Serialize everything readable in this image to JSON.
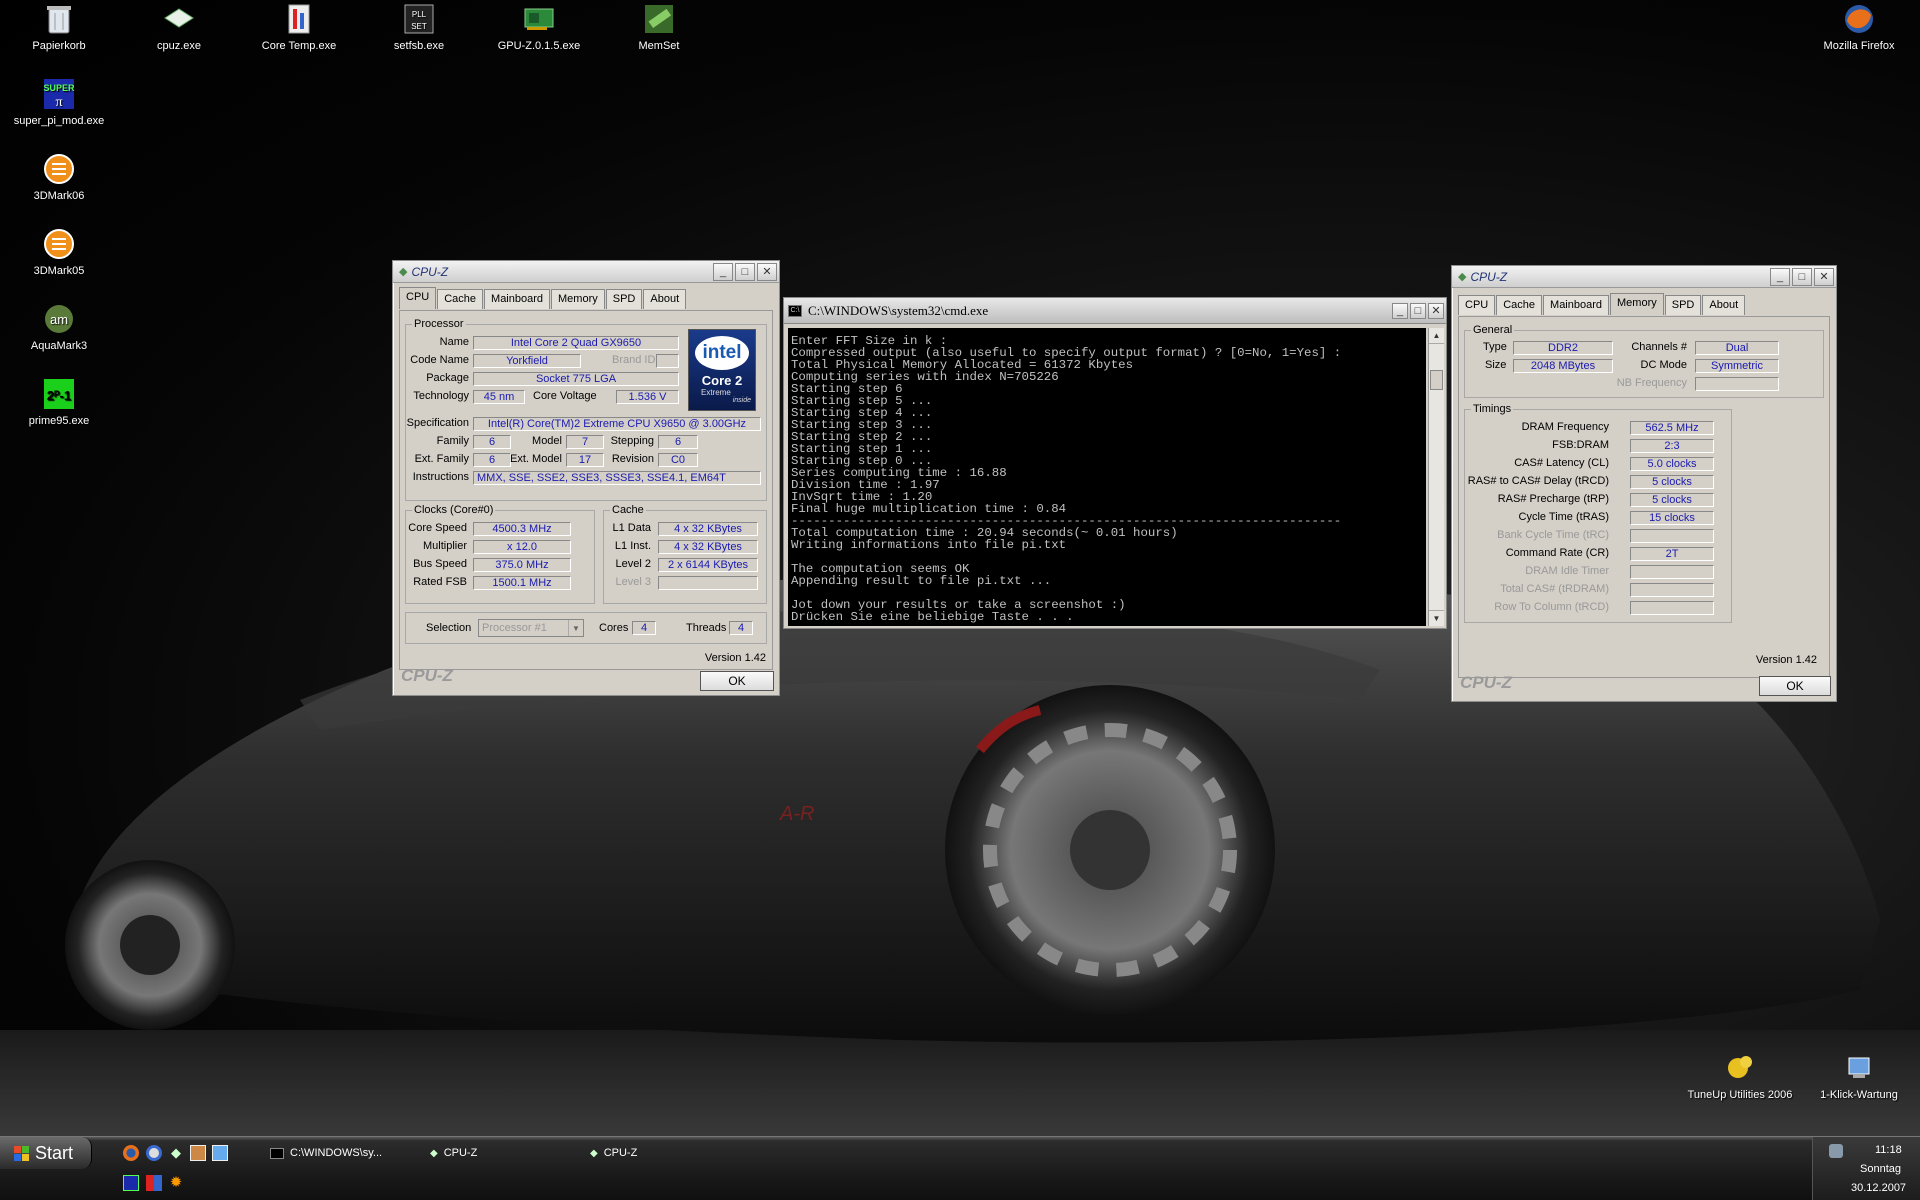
{
  "desktop_icons": [
    {
      "label": "Papierkorb",
      "icon": "recycle-bin-icon"
    },
    {
      "label": "cpuz.exe",
      "icon": "cpuz-icon"
    },
    {
      "label": "Core Temp.exe",
      "icon": "core-temp-icon"
    },
    {
      "label": "setfsb.exe",
      "icon": "setfsb-icon"
    },
    {
      "label": "GPU-Z.0.1.5.exe",
      "icon": "gpuz-icon"
    },
    {
      "label": "MemSet",
      "icon": "memset-icon"
    },
    {
      "label": "Mozilla Firefox",
      "icon": "firefox-icon"
    },
    {
      "label": "super_pi_mod.exe",
      "icon": "superpi-icon"
    },
    {
      "label": "3DMark06",
      "icon": "3dmark-icon"
    },
    {
      "label": "3DMark05",
      "icon": "3dmark-icon"
    },
    {
      "label": "AquaMark3",
      "icon": "aquamark-icon"
    },
    {
      "label": "prime95.exe",
      "icon": "prime95-icon"
    },
    {
      "label": "TuneUp Utilities 2006",
      "icon": "tuneup-icon"
    },
    {
      "label": "1-Klick-Wartung",
      "icon": "klick-wartung-icon"
    }
  ],
  "cpuz_left": {
    "title": "CPU-Z",
    "tabs": [
      "CPU",
      "Cache",
      "Mainboard",
      "Memory",
      "SPD",
      "About"
    ],
    "processor_group": "Processor",
    "name_label": "Name",
    "name": "Intel Core 2 Quad GX9650",
    "codename_label": "Code Name",
    "codename": "Yorkfield",
    "brandid_label": "Brand ID",
    "package_label": "Package",
    "package": "Socket 775 LGA",
    "technology_label": "Technology",
    "technology": "45 nm",
    "corevoltage_label": "Core Voltage",
    "corevoltage": "1.536 V",
    "spec_label": "Specification",
    "spec": "Intel(R) Core(TM)2 Extreme CPU X9650  @ 3.00GHz",
    "family_label": "Family",
    "family": "6",
    "model_label": "Model",
    "model": "7",
    "stepping_label": "Stepping",
    "stepping": "6",
    "extfamily_label": "Ext. Family",
    "extfamily": "6",
    "extmodel_label": "Ext. Model",
    "extmodel": "17",
    "revision_label": "Revision",
    "revision": "C0",
    "instructions_label": "Instructions",
    "instructions": "MMX, SSE, SSE2, SSE3, SSSE3, SSE4.1, EM64T",
    "logo_brand": "intel",
    "logo_line1": "Core 2",
    "logo_line2": "Extreme",
    "logo_line3": "inside",
    "clocks_group": "Clocks (Core#0)",
    "corespeed_label": "Core Speed",
    "corespeed": "4500.3 MHz",
    "multiplier_label": "Multiplier",
    "multiplier": "x 12.0",
    "busspeed_label": "Bus Speed",
    "busspeed": "375.0 MHz",
    "ratedfsb_label": "Rated FSB",
    "ratedfsb": "1500.1 MHz",
    "cache_group": "Cache",
    "l1data_label": "L1 Data",
    "l1data": "4 x 32 KBytes",
    "l1inst_label": "L1 Inst.",
    "l1inst": "4 x 32 KBytes",
    "level2_label": "Level 2",
    "level2": "2 x 6144 KBytes",
    "level3_label": "Level 3",
    "selection_label": "Selection",
    "selection": "Processor #1",
    "cores_label": "Cores",
    "cores": "4",
    "threads_label": "Threads",
    "threads": "4",
    "version": "Version 1.42",
    "brand": "CPU-Z",
    "ok": "OK"
  },
  "cmd": {
    "title": "C:\\WINDOWS\\system32\\cmd.exe",
    "lines": [
      "Enter FFT Size in k :",
      "Compressed output (also useful to specify output format) ? [0=No, 1=Yes] :",
      "Total Physical Memory Allocated = 61372 Kbytes",
      "Computing series with index N=705226",
      "Starting step 6",
      "Starting step 5 ...",
      "Starting step 4 ...",
      "Starting step 3 ...",
      "Starting step 2 ...",
      "Starting step 1 ...",
      "Starting step 0 ...",
      "Series computing time : 16.88",
      "Division time : 1.97",
      "InvSqrt time : 1.20",
      "Final huge multiplication time : 0.84",
      "--------------------------------------------------------------------------",
      "Total computation time : 20.94 seconds(~ 0.01 hours)",
      "Writing informations into file pi.txt",
      "",
      "The computation seems OK",
      "Appending result to file pi.txt ...",
      "",
      "Jot down your results or take a screenshot :)",
      "Drücken Sie eine beliebige Taste . . ."
    ]
  },
  "cpuz_right": {
    "title": "CPU-Z",
    "tabs": [
      "CPU",
      "Cache",
      "Mainboard",
      "Memory",
      "SPD",
      "About"
    ],
    "general_group": "General",
    "type_label": "Type",
    "type": "DDR2",
    "size_label": "Size",
    "size": "2048 MBytes",
    "channels_label": "Channels #",
    "channels": "Dual",
    "dcmode_label": "DC Mode",
    "dcmode": "Symmetric",
    "nbfreq_label": "NB Frequency",
    "timings_group": "Timings",
    "dramfreq_label": "DRAM Frequency",
    "dramfreq": "562.5 MHz",
    "fsbdram_label": "FSB:DRAM",
    "fsbdram": "2:3",
    "cas_label": "CAS# Latency (CL)",
    "cas": "5.0 clocks",
    "trcd_label": "RAS# to CAS# Delay (tRCD)",
    "trcd": "5 clocks",
    "trp_label": "RAS# Precharge (tRP)",
    "trp": "5 clocks",
    "tras_label": "Cycle Time (tRAS)",
    "tras": "15 clocks",
    "trc_label": "Bank Cycle Time (tRC)",
    "cr_label": "Command Rate (CR)",
    "cr": "2T",
    "idle_label": "DRAM Idle Timer",
    "trdram_label": "Total CAS# (tRDRAM)",
    "trcd2_label": "Row To Column (tRCD)",
    "version": "Version 1.42",
    "brand": "CPU-Z",
    "ok": "OK"
  },
  "taskbar": {
    "start": "Start",
    "tasks": [
      "C:\\WINDOWS\\sy...",
      "CPU-Z",
      "CPU-Z"
    ],
    "time": "11:18",
    "day": "Sonntag",
    "date": "30.12.2007"
  }
}
